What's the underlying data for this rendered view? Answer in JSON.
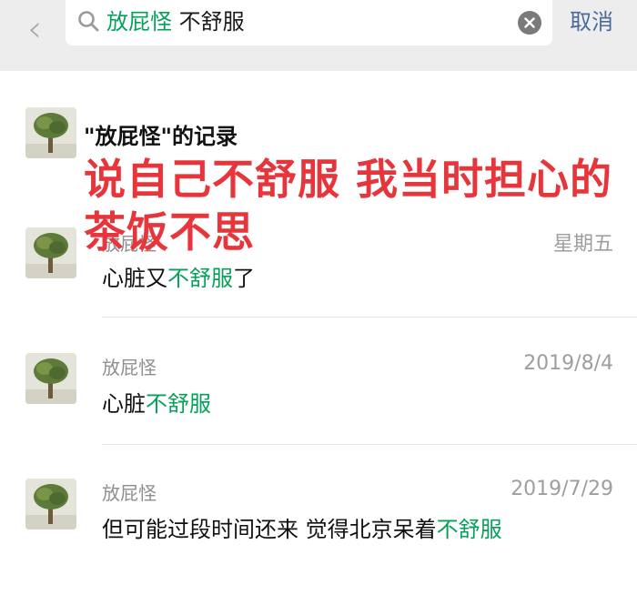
{
  "search": {
    "back_icon": "chevron-left-icon",
    "query_highlight": "放屁怪",
    "query_rest": " 不舒服",
    "cancel_label": "取消"
  },
  "header": {
    "title": "\"放屁怪\"的记录"
  },
  "overlay_caption": "说自己不舒服 我当时担心的茶饭不思",
  "results": [
    {
      "name": "放屁怪",
      "date": "星期五",
      "message_before": "心脏又",
      "message_highlight": "不舒服",
      "message_after": "了"
    },
    {
      "name": "放屁怪",
      "date": "2019/8/4",
      "message_before": "心脏",
      "message_highlight": "不舒服",
      "message_after": ""
    },
    {
      "name": "放屁怪",
      "date": "2019/7/29",
      "message_before": "但可能过段时间还来 觉得北京呆着",
      "message_highlight": "不舒服",
      "message_after": ""
    }
  ],
  "colors": {
    "highlight": "#07a05a",
    "overlay_text": "#e7353c",
    "cancel": "#4a6b9a",
    "search_bg": "#ededed"
  }
}
